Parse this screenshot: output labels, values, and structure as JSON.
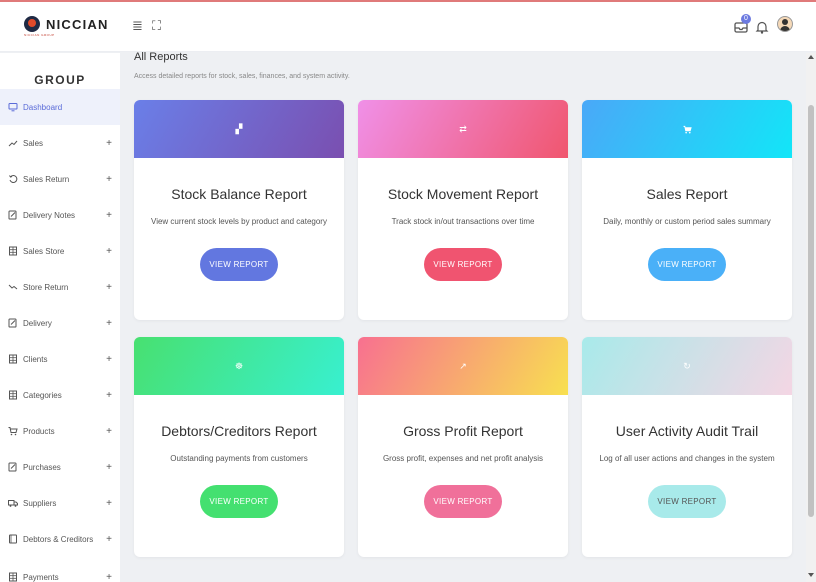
{
  "header": {
    "brand": "NICCIAN",
    "brand_sub": "NICCIAN GROUP",
    "menu_glyph": "≣",
    "expand_glyph": "⛶",
    "notification_count": "0"
  },
  "sidebar": {
    "group_title": "GROUP",
    "items": [
      {
        "label": "Dashboard",
        "icon": "monitor-icon",
        "active": true
      },
      {
        "label": "Sales",
        "icon": "trend-up-icon",
        "plus": "+"
      },
      {
        "label": "Sales Return",
        "icon": "rotate-back-icon",
        "plus": "+"
      },
      {
        "label": "Delivery Notes",
        "icon": "edit-note-icon",
        "plus": "+"
      },
      {
        "label": "Sales Store",
        "icon": "grid-icon",
        "plus": "+"
      },
      {
        "label": "Store Return",
        "icon": "trend-down-icon",
        "plus": "+"
      },
      {
        "label": "Delivery",
        "icon": "edit-note-icon",
        "plus": "+"
      },
      {
        "label": "Clients",
        "icon": "grid-icon",
        "plus": "+"
      },
      {
        "label": "Categories",
        "icon": "grid-icon",
        "plus": "+"
      },
      {
        "label": "Products",
        "icon": "cart-icon",
        "plus": "+"
      },
      {
        "label": "Purchases",
        "icon": "edit-note-icon",
        "plus": "+"
      },
      {
        "label": "Suppliers",
        "icon": "truck-icon",
        "plus": "+"
      },
      {
        "label": "Debtors & Creditors",
        "icon": "book-icon",
        "plus": "+"
      },
      {
        "label": "Payments",
        "icon": "grid-icon",
        "plus": "+"
      }
    ]
  },
  "main": {
    "title": "All Reports",
    "subtitle": "Access detailed reports for stock, sales, finances, and system activity.",
    "cards": [
      {
        "title": "Stock Balance Report",
        "desc": "View current stock levels by product and category",
        "button": "VIEW REPORT",
        "icon_glyph": "▞",
        "icon": "boxes-icon",
        "gradient": [
          "#6a7fe8",
          "#7a4fb0"
        ],
        "btn_color": "#6277e0"
      },
      {
        "title": "Stock Movement Report",
        "desc": "Track stock in/out transactions over time",
        "button": "VIEW REPORT",
        "icon_glyph": "⇄",
        "icon": "exchange-icon",
        "gradient": [
          "#f090e8",
          "#f0566e"
        ],
        "btn_color": "#f05470"
      },
      {
        "title": "Sales Report",
        "desc": "Daily, monthly or custom period sales summary",
        "button": "VIEW REPORT",
        "icon_glyph": "🛒",
        "icon": "cart-icon",
        "gradient": [
          "#4aa8f8",
          "#12e6f8"
        ],
        "btn_color": "#4ab0f8"
      },
      {
        "title": "Debtors/Creditors Report",
        "desc": "Outstanding payments from customers",
        "button": "VIEW REPORT",
        "icon_glyph": "☸",
        "icon": "handshake-icon",
        "gradient": [
          "#48e070",
          "#38f0d0"
        ],
        "btn_color": "#44e070"
      },
      {
        "title": "Gross Profit Report",
        "desc": "Gross profit, expenses and net profit analysis",
        "button": "VIEW REPORT",
        "icon_glyph": "↗",
        "icon": "chart-line-icon",
        "gradient": [
          "#f87090",
          "#f8e050"
        ],
        "btn_color": "#f0709a"
      },
      {
        "title": "User Activity Audit Trail",
        "desc": "Log of all user actions and changes in the system",
        "button": "VIEW REPORT",
        "icon_glyph": "↻",
        "icon": "history-icon",
        "gradient": [
          "#a8eaea",
          "#f4d6e4"
        ],
        "btn_color": "#a8eaea",
        "btn_text_color": "#555"
      }
    ]
  }
}
